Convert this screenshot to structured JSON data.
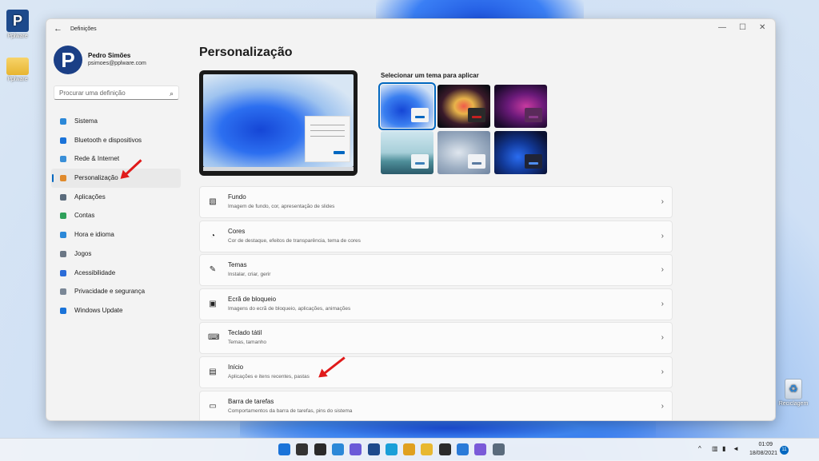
{
  "desktop": {
    "icons": [
      {
        "label": "Pplware"
      },
      {
        "label": "Pplware"
      },
      {
        "label": "Reciclagem"
      }
    ]
  },
  "window": {
    "title": "Definições",
    "controls": {
      "minimize": "—",
      "maximize": "☐",
      "close": "✕"
    },
    "back_glyph": "←"
  },
  "profile": {
    "initial": "P",
    "name": "Pedro Simões",
    "email": "psimoes@pplware.com"
  },
  "search": {
    "placeholder": "Procurar uma definição",
    "icon": "search-icon"
  },
  "nav": {
    "items": [
      {
        "label": "Sistema",
        "icon": "system-icon",
        "color": "#2b88d8"
      },
      {
        "label": "Bluetooth e dispositivos",
        "icon": "bluetooth-icon",
        "color": "#1a73d9"
      },
      {
        "label": "Rede & Internet",
        "icon": "wifi-icon",
        "color": "#3a8fd8"
      },
      {
        "label": "Personalização",
        "icon": "brush-icon",
        "color": "#e08a2c",
        "active": true
      },
      {
        "label": "Aplicações",
        "icon": "apps-icon",
        "color": "#5a6b7c"
      },
      {
        "label": "Contas",
        "icon": "account-icon",
        "color": "#2ea05a"
      },
      {
        "label": "Hora e idioma",
        "icon": "globe-icon",
        "color": "#2b88d8"
      },
      {
        "label": "Jogos",
        "icon": "gamepad-icon",
        "color": "#6b7785"
      },
      {
        "label": "Acessibilidade",
        "icon": "accessibility-icon",
        "color": "#2b6cd8"
      },
      {
        "label": "Privacidade e segurança",
        "icon": "shield-icon",
        "color": "#7a8796"
      },
      {
        "label": "Windows Update",
        "icon": "update-icon",
        "color": "#1a73d9"
      }
    ]
  },
  "main": {
    "title": "Personalização",
    "themes_label": "Selecionar um tema para aplicar",
    "themes": [
      {
        "name": "windows-light",
        "bg": "radial-gradient(ellipse at 40% 60%, #1546d6 0%, #3a7ff0 40%, #cfe0f5 80%)",
        "box": "#f3f3f3",
        "btn": "#0067c0",
        "selected": true
      },
      {
        "name": "glow",
        "bg": "radial-gradient(ellipse at 50% 50%, #f05a4a 0%, #e8b44a 25%, #3a1a2a 60%, #0d0d14 90%)",
        "box": "#2a2a2a",
        "btn": "#c42020"
      },
      {
        "name": "captured-motion",
        "bg": "radial-gradient(ellipse at 60% 50%, #c83aa0 0%, #6b1a7a 40%, #1a0a2a 85%)",
        "box": "#5a2a5a",
        "btn": "#8a3a8a"
      },
      {
        "name": "sunrise",
        "bg": "linear-gradient(#cfe6ef 0%, #a7cfd9 50%, #4f8f9a 70%, #2a5a6a 100%)",
        "box": "#eef3f5",
        "btn": "#3a7fb8"
      },
      {
        "name": "flow",
        "bg": "radial-gradient(ellipse at 40% 50%, #dfe6ee 0%, #9fb0c4 50%, #6f84a0 100%)",
        "box": "#f0f2f5",
        "btn": "#5a7aa0"
      },
      {
        "name": "windows-dark",
        "bg": "radial-gradient(ellipse at 45% 60%, #2a6cf0 0%, #123a9a 40%, #0a1030 85%)",
        "box": "#202436",
        "btn": "#4f8ef0"
      }
    ],
    "settings": [
      {
        "title": "Fundo",
        "subtitle": "Imagem de fundo, cor, apresentação de slides",
        "icon": "image-icon",
        "glyph": "▧"
      },
      {
        "title": "Cores",
        "subtitle": "Cor de destaque, efeitos de transparência, tema de cores",
        "icon": "palette-icon",
        "glyph": "◔"
      },
      {
        "title": "Temas",
        "subtitle": "Instalar, criar, gerir",
        "icon": "pen-icon",
        "glyph": "✎"
      },
      {
        "title": "Ecrã de bloqueio",
        "subtitle": "Imagens do ecrã de bloqueio, aplicações, animações",
        "icon": "lock-screen-icon",
        "glyph": "▣"
      },
      {
        "title": "Teclado tátil",
        "subtitle": "Temas, tamanho",
        "icon": "keyboard-icon",
        "glyph": "⌨"
      },
      {
        "title": "Início",
        "subtitle": "Aplicações e itens recentes, pastas",
        "icon": "start-icon",
        "glyph": "▤"
      },
      {
        "title": "Barra de tarefas",
        "subtitle": "Comportamentos da barra de tarefas, pins do sistema",
        "icon": "taskbar-icon",
        "glyph": "▭"
      }
    ],
    "chevron": "›"
  },
  "taskbar": {
    "apps": [
      {
        "name": "start-icon",
        "color": "#1a73d9"
      },
      {
        "name": "search-icon",
        "color": "#333333"
      },
      {
        "name": "task-view-icon",
        "color": "#2a2a2a"
      },
      {
        "name": "widgets-icon",
        "color": "#2b88d8"
      },
      {
        "name": "chat-icon",
        "color": "#6a5ad8"
      },
      {
        "name": "pplware-icon",
        "color": "#1d4a8c"
      },
      {
        "name": "edge-icon",
        "color": "#1a9fd8"
      },
      {
        "name": "chrome-icon",
        "color": "#e0a020"
      },
      {
        "name": "file-explorer-icon",
        "color": "#e8b830"
      },
      {
        "name": "terminal-icon",
        "color": "#2a2a2a"
      },
      {
        "name": "vscode-icon",
        "color": "#2a7ad8"
      },
      {
        "name": "paint-icon",
        "color": "#7a5ad8"
      },
      {
        "name": "settings-icon",
        "color": "#5a6b7c"
      }
    ],
    "tray_chevron": "^",
    "time": "01:09",
    "date": "18/08/2021",
    "notifications": "11"
  }
}
